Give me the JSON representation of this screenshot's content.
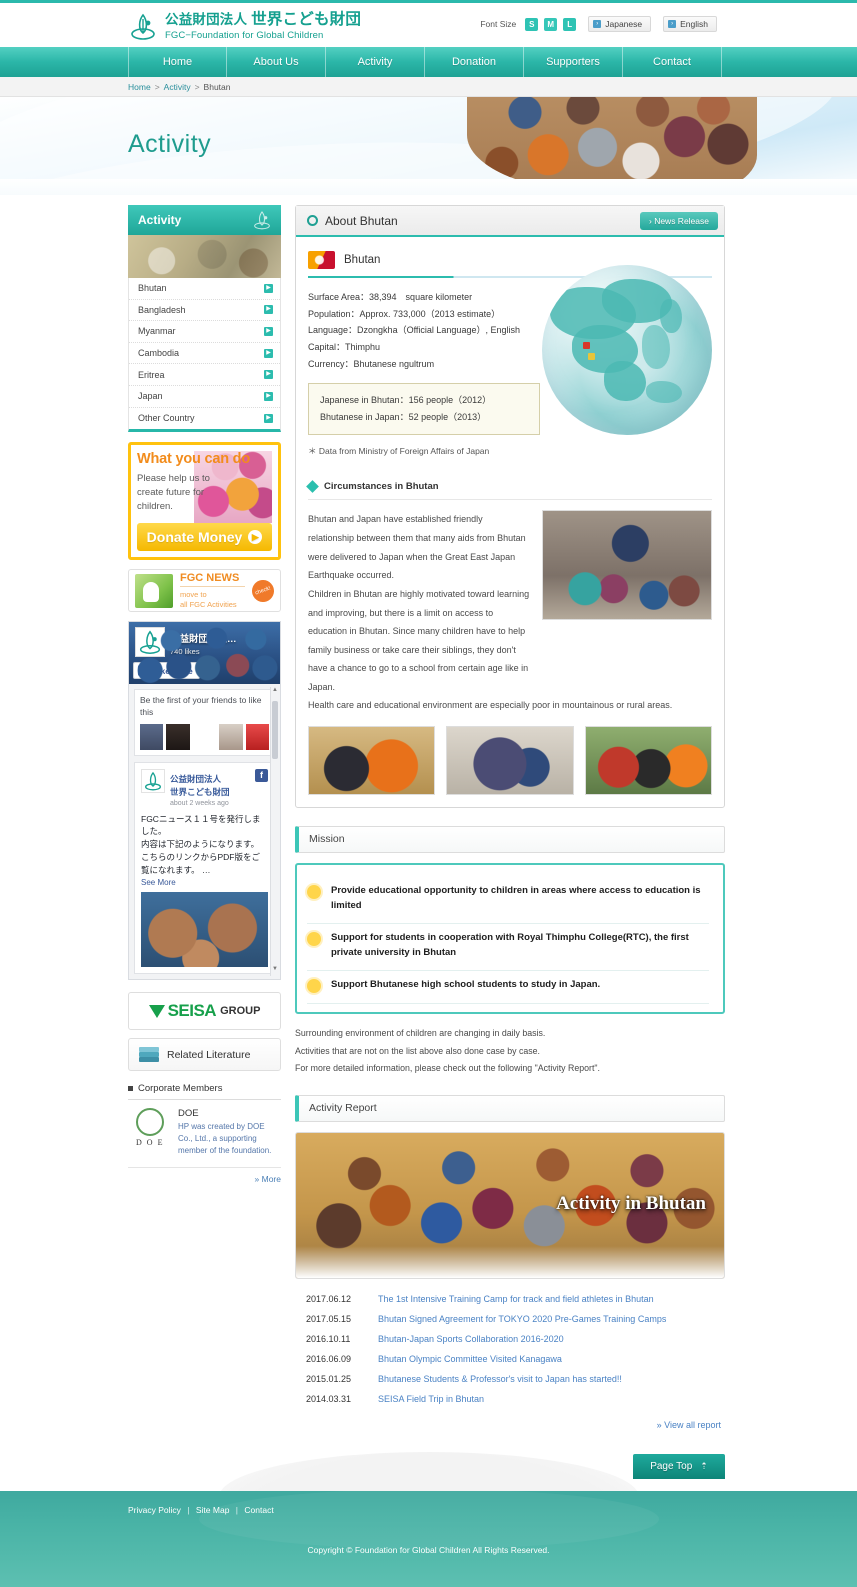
{
  "header": {
    "logo_jp_small": "公益財団法人 ",
    "logo_jp_big": "世界こども財団",
    "logo_en": "FGC−Foundation for Global Children",
    "font_size_label": "Font Size",
    "font_sizes": [
      "S",
      "M",
      "L"
    ],
    "lang_japanese": "Japanese",
    "lang_english": "English"
  },
  "nav": {
    "items": [
      "Home",
      "About Us",
      "Activity",
      "Donation",
      "Supporters",
      "Contact"
    ]
  },
  "breadcrumb": {
    "home": "Home",
    "activity": "Activity",
    "current": "Bhutan",
    "sep": ">"
  },
  "hero": {
    "title": "Activity"
  },
  "sidebar": {
    "activity_title": "Activity",
    "countries": [
      "Bhutan",
      "Bangladesh",
      "Myanmar",
      "Cambodia",
      "Eritrea",
      "Japan",
      "Other Country"
    ],
    "donate": {
      "title": "What you can do",
      "sub": "Please help us to create future for children.",
      "button": "Donate Money"
    },
    "fgc_news": {
      "title": "FGC NEWS",
      "line1": "move to",
      "line2": "all FGC Activities",
      "check": "check!"
    },
    "facebook": {
      "page_name": "公益財団法人…",
      "likes": "740 likes",
      "like_button": "Like Page",
      "friends_text": "Be the first of your friends to like this",
      "post_name_l1": "公益財団法人",
      "post_name_l2": "世界こども財団",
      "post_time": "about 2 weeks ago",
      "post_body": "FGCニュース１１号を発行しました。\n内容は下記のようになります。\nこちらのリンクからPDF版をご覧になれます。 …",
      "see_more": "See More"
    },
    "seisa": {
      "name": "SEISA",
      "group": "GROUP"
    },
    "related_literature": "Related Literature",
    "corporate_members_title": "Corporate Members",
    "corporate_member": {
      "logo_text": "D O E",
      "name": "DOE",
      "desc": "HP was created by DOE Co., Ltd., a supporting member of the foundation."
    },
    "more_link": "» More"
  },
  "main": {
    "panel_title": "About Bhutan",
    "news_release_button": "› News Release",
    "country_name": "Bhutan",
    "facts": [
      "Surface Area：38,394　square kilometer",
      "Population：Approx. 733,000（2013 estimate）",
      "Language：Dzongkha（Official Language）, English",
      "Capital：Thimphu",
      "Currency：Bhutanese ngultrum"
    ],
    "factbox": [
      "Japanese in Bhutan：156 people（2012）",
      "Bhutanese in Japan：52 people（2013）"
    ],
    "footnote": "＊ Data from Ministry of Foreign Affairs of Japan",
    "circumstances_title": "Circumstances in Bhutan",
    "circumstances_text": "Bhutan and Japan have established friendly relationship between them that many aids from Bhutan were delivered to Japan when the Great East Japan Earthquake occurred.\nChildren in Bhutan are highly motivated toward learning and improving, but there is a limit on access to education in Bhutan. Since many children have to help family business or take care their siblings, they don't have a chance to go to a school from certain age like in Japan.",
    "circumstances_note": "Health care and educational environment are especially poor in mountainous or rural areas.",
    "mission_title": "Mission",
    "missions": [
      "Provide educational opportunity to children in areas where access to education is limited",
      "Support for students in cooperation with Royal Thimphu College(RTC), the first private university in Bhutan",
      "Support Bhutanese high school students to study in Japan."
    ],
    "after_mission": [
      "Surrounding environment of children are changing in daily basis.",
      "Activities that are not on the list above also done case by case.",
      "For more detailed information, please check out the following \"Activity Report\"."
    ],
    "activity_report_title": "Activity Report",
    "report_caption": "Activity in Bhutan",
    "reports": [
      {
        "date": "2017.06.12",
        "title": "The 1st Intensive Training Camp for track and field athletes in Bhutan"
      },
      {
        "date": "2017.05.15",
        "title": "Bhutan Signed Agreement for TOKYO 2020 Pre-Games Training Camps"
      },
      {
        "date": "2016.10.11",
        "title": "Bhutan-Japan Sports Collaboration 2016-2020"
      },
      {
        "date": "2016.06.09",
        "title": "Bhutan Olympic Committee Visited Kanagawa"
      },
      {
        "date": "2015.01.25",
        "title": "Bhutanese Students & Professor's visit to Japan has started!!"
      },
      {
        "date": "2014.03.31",
        "title": "SEISA Field Trip in Bhutan"
      }
    ],
    "view_all": "» View all report"
  },
  "footer": {
    "page_top": "Page Top",
    "links": [
      "Privacy Policy",
      "Site Map",
      "Contact"
    ],
    "separator": "|",
    "copyright": "Copyright © Foundation for Global Children All Rights Reserved."
  },
  "colors": {
    "teal": "#2bb9ac",
    "teal_dark": "#1fa093",
    "yellow": "#ffc20e",
    "orange": "#f08c22",
    "link_blue": "#4a82c4"
  }
}
